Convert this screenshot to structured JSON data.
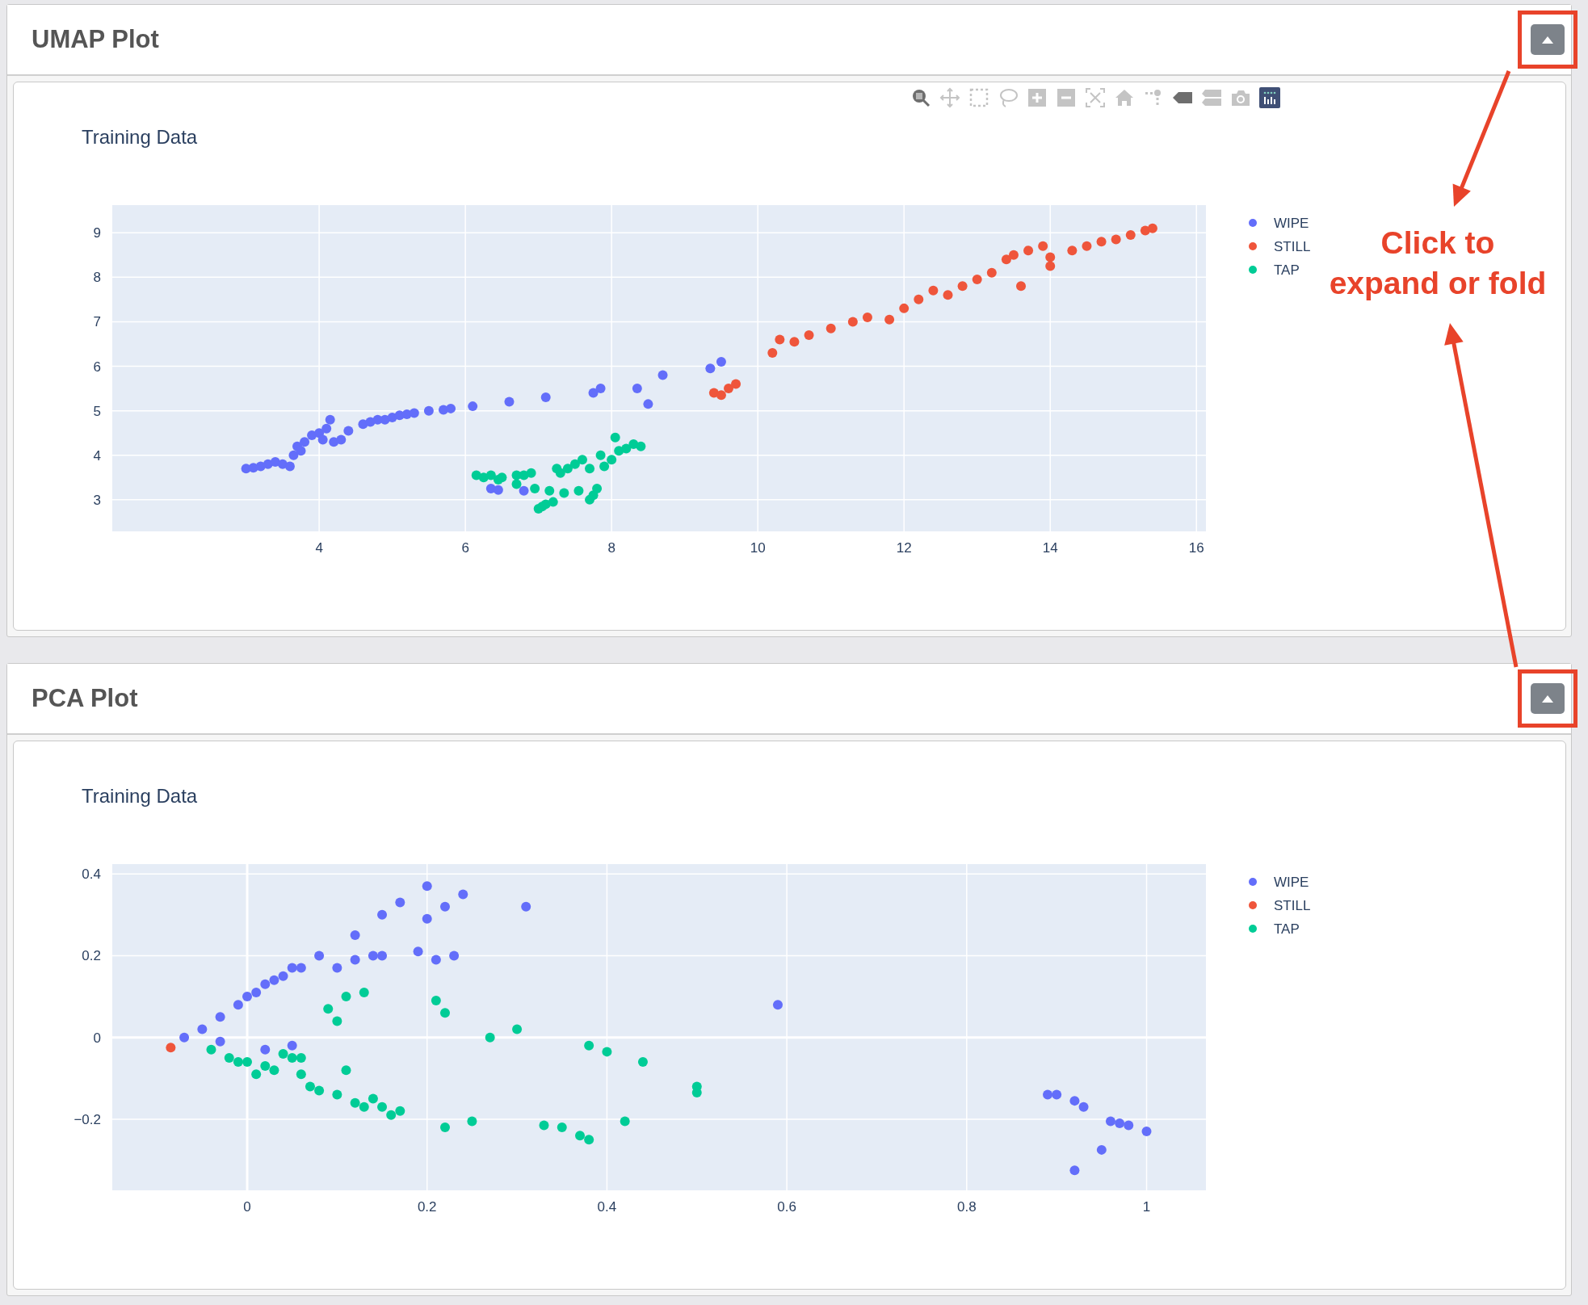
{
  "panels": [
    {
      "title": "UMAP Plot",
      "expanded": true,
      "highlighted": true,
      "modebar": [
        {
          "kind": "zoom",
          "selected": true
        },
        {
          "kind": "pan",
          "selected": false
        },
        {
          "kind": "box-select",
          "selected": false
        },
        {
          "kind": "lasso",
          "selected": false
        },
        {
          "kind": "zoom-in",
          "selected": false
        },
        {
          "kind": "zoom-out",
          "selected": false
        },
        {
          "kind": "autoscale",
          "selected": false
        },
        {
          "kind": "reset",
          "selected": false
        },
        {
          "kind": "spikes",
          "selected": false
        },
        {
          "kind": "hover-closest",
          "selected": true
        },
        {
          "kind": "hover-compare",
          "selected": false
        },
        {
          "kind": "camera",
          "selected": false
        },
        {
          "kind": "logo",
          "selected": true
        }
      ],
      "chart_data": {
        "type": "scatter",
        "title": "Training Data",
        "grid": true,
        "legend": true,
        "xlim": [
          1.17,
          16.13
        ],
        "ylim": [
          2.29,
          9.62
        ],
        "xticks": [
          {
            "value": 4,
            "label": "4"
          },
          {
            "value": 6,
            "label": "6"
          },
          {
            "value": 8,
            "label": "8"
          },
          {
            "value": 10,
            "label": "10"
          },
          {
            "value": 12,
            "label": "12"
          },
          {
            "value": 14,
            "label": "14"
          },
          {
            "value": 16,
            "label": "16"
          }
        ],
        "yticks": [
          {
            "value": 3,
            "label": "3"
          },
          {
            "value": 4,
            "label": "4"
          },
          {
            "value": 5,
            "label": "5"
          },
          {
            "value": 6,
            "label": "6"
          },
          {
            "value": 7,
            "label": "7"
          },
          {
            "value": 8,
            "label": "8"
          },
          {
            "value": 9,
            "label": "9"
          }
        ],
        "series": [
          {
            "name": "WIPE",
            "color": "#636efa",
            "x": [
              3.0,
              3.1,
              3.2,
              3.3,
              3.4,
              3.5,
              3.6,
              3.65,
              3.7,
              3.75,
              3.8,
              3.9,
              4.0,
              4.05,
              4.1,
              4.15,
              4.2,
              4.3,
              4.4,
              4.6,
              4.7,
              4.8,
              4.9,
              5.0,
              5.1,
              5.2,
              5.3,
              5.5,
              5.7,
              5.8,
              6.1,
              6.6,
              7.1,
              7.75,
              7.85,
              8.35,
              8.5,
              8.7,
              9.35,
              9.5,
              6.35,
              6.45,
              6.8
            ],
            "values": [
              3.7,
              3.72,
              3.75,
              3.8,
              3.85,
              3.8,
              3.75,
              4.0,
              4.2,
              4.1,
              4.3,
              4.45,
              4.5,
              4.35,
              4.6,
              4.8,
              4.3,
              4.35,
              4.55,
              4.7,
              4.75,
              4.8,
              4.8,
              4.85,
              4.9,
              4.92,
              4.95,
              5.0,
              5.02,
              5.05,
              5.1,
              5.2,
              5.3,
              5.4,
              5.5,
              5.5,
              5.15,
              5.8,
              5.95,
              6.1,
              3.25,
              3.22,
              3.2
            ]
          },
          {
            "name": "STILL",
            "color": "#ef553b",
            "x": [
              9.4,
              9.5,
              9.6,
              9.7,
              10.2,
              10.3,
              10.5,
              10.7,
              11.0,
              11.3,
              11.5,
              11.8,
              12.0,
              12.2,
              12.4,
              12.6,
              12.8,
              13.0,
              13.2,
              13.4,
              13.5,
              13.7,
              13.9,
              14.0,
              14.3,
              14.5,
              14.7,
              14.9,
              15.1,
              15.3,
              15.4,
              13.6,
              14.0
            ],
            "values": [
              5.4,
              5.35,
              5.5,
              5.6,
              6.3,
              6.6,
              6.55,
              6.7,
              6.85,
              7.0,
              7.1,
              7.05,
              7.3,
              7.5,
              7.7,
              7.6,
              7.8,
              7.95,
              8.1,
              8.4,
              8.5,
              8.6,
              8.7,
              8.45,
              8.6,
              8.7,
              8.8,
              8.85,
              8.95,
              9.05,
              9.1,
              7.8,
              8.25
            ]
          },
          {
            "name": "TAP",
            "color": "#00cc96",
            "x": [
              6.15,
              6.25,
              6.35,
              6.45,
              6.5,
              6.7,
              6.8,
              6.9,
              6.95,
              7.0,
              7.05,
              7.1,
              7.2,
              7.3,
              7.4,
              7.5,
              7.6,
              7.7,
              7.75,
              7.8,
              7.85,
              7.9,
              8.0,
              8.05,
              8.1,
              8.2,
              8.3,
              8.4,
              7.15,
              7.25,
              7.55,
              7.7,
              6.7,
              7.35
            ],
            "values": [
              3.55,
              3.5,
              3.55,
              3.45,
              3.5,
              3.55,
              3.55,
              3.6,
              3.25,
              2.8,
              2.85,
              2.9,
              2.95,
              3.6,
              3.7,
              3.8,
              3.9,
              3.7,
              3.1,
              3.25,
              4.0,
              3.75,
              3.9,
              4.4,
              4.1,
              4.15,
              4.25,
              4.2,
              3.2,
              3.7,
              3.2,
              3.0,
              3.35,
              3.15
            ]
          }
        ]
      }
    },
    {
      "title": "PCA Plot",
      "expanded": true,
      "highlighted": true,
      "chart_data": {
        "type": "scatter",
        "title": "Training Data",
        "grid": true,
        "legend": true,
        "xlim": [
          -0.15,
          1.066
        ],
        "ylim": [
          -0.374,
          0.424
        ],
        "xticks": [
          {
            "value": 0,
            "label": "0"
          },
          {
            "value": 0.2,
            "label": "0.2"
          },
          {
            "value": 0.4,
            "label": "0.4"
          },
          {
            "value": 0.6,
            "label": "0.6"
          },
          {
            "value": 0.8,
            "label": "0.8"
          },
          {
            "value": 1,
            "label": "1"
          }
        ],
        "yticks": [
          {
            "value": -0.2,
            "label": "−0.2"
          },
          {
            "value": 0,
            "label": "0"
          },
          {
            "value": 0.2,
            "label": "0.2"
          },
          {
            "value": 0.4,
            "label": "0.4"
          }
        ],
        "series": [
          {
            "name": "WIPE",
            "color": "#636efa",
            "x": [
              -0.07,
              -0.05,
              -0.03,
              -0.01,
              0.0,
              0.01,
              0.02,
              0.03,
              0.04,
              0.05,
              0.06,
              0.08,
              0.1,
              0.12,
              0.15,
              0.17,
              0.2,
              0.24,
              0.31,
              0.2,
              0.22,
              0.15,
              0.19,
              0.21,
              0.23,
              0.14,
              0.12,
              0.05,
              0.02,
              -0.03,
              0.59,
              0.89,
              0.9,
              0.92,
              0.93,
              0.96,
              0.97,
              0.98,
              1.0,
              0.95,
              0.92
            ],
            "values": [
              0.0,
              0.02,
              0.05,
              0.08,
              0.1,
              0.11,
              0.13,
              0.14,
              0.15,
              0.17,
              0.17,
              0.2,
              0.17,
              0.25,
              0.3,
              0.33,
              0.37,
              0.35,
              0.32,
              0.29,
              0.32,
              0.2,
              0.21,
              0.19,
              0.2,
              0.2,
              0.19,
              -0.02,
              -0.03,
              -0.01,
              0.08,
              -0.14,
              -0.14,
              -0.155,
              -0.17,
              -0.205,
              -0.21,
              -0.215,
              -0.23,
              -0.275,
              -0.325
            ]
          },
          {
            "name": "STILL",
            "color": "#ef553b",
            "x": [
              -0.085
            ],
            "values": [
              -0.025
            ]
          },
          {
            "name": "TAP",
            "color": "#00cc96",
            "x": [
              -0.04,
              -0.02,
              0.0,
              0.02,
              0.03,
              0.05,
              0.06,
              0.04,
              0.01,
              -0.01,
              0.07,
              0.08,
              0.1,
              0.12,
              0.13,
              0.14,
              0.16,
              0.17,
              0.06,
              0.09,
              0.1,
              0.11,
              0.13,
              0.21,
              0.22,
              0.27,
              0.3,
              0.38,
              0.4,
              0.44,
              0.5,
              0.5,
              0.33,
              0.35,
              0.37,
              0.38,
              0.42,
              0.25,
              0.22,
              0.15,
              0.11
            ],
            "values": [
              -0.03,
              -0.05,
              -0.06,
              -0.07,
              -0.08,
              -0.05,
              -0.09,
              -0.04,
              -0.09,
              -0.06,
              -0.12,
              -0.13,
              -0.14,
              -0.16,
              -0.17,
              -0.15,
              -0.19,
              -0.18,
              -0.05,
              0.07,
              0.04,
              0.1,
              0.11,
              0.09,
              0.06,
              0.0,
              0.02,
              -0.02,
              -0.035,
              -0.06,
              -0.12,
              -0.135,
              -0.215,
              -0.22,
              -0.24,
              -0.25,
              -0.205,
              -0.205,
              -0.22,
              -0.17,
              -0.08
            ]
          }
        ]
      }
    }
  ],
  "callout": {
    "text": "Click to expand or fold"
  }
}
